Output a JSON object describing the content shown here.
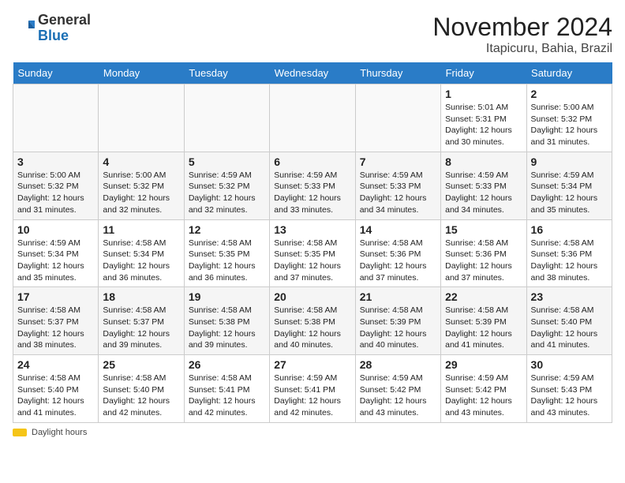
{
  "header": {
    "logo_general": "General",
    "logo_blue": "Blue",
    "month_title": "November 2024",
    "location": "Itapicuru, Bahia, Brazil"
  },
  "legend": {
    "icon": "sun-icon",
    "label": "Daylight hours"
  },
  "weekdays": [
    "Sunday",
    "Monday",
    "Tuesday",
    "Wednesday",
    "Thursday",
    "Friday",
    "Saturday"
  ],
  "weeks": [
    [
      {
        "day": "",
        "details": ""
      },
      {
        "day": "",
        "details": ""
      },
      {
        "day": "",
        "details": ""
      },
      {
        "day": "",
        "details": ""
      },
      {
        "day": "",
        "details": ""
      },
      {
        "day": "1",
        "details": "Sunrise: 5:01 AM\nSunset: 5:31 PM\nDaylight: 12 hours and 30 minutes."
      },
      {
        "day": "2",
        "details": "Sunrise: 5:00 AM\nSunset: 5:32 PM\nDaylight: 12 hours and 31 minutes."
      }
    ],
    [
      {
        "day": "3",
        "details": "Sunrise: 5:00 AM\nSunset: 5:32 PM\nDaylight: 12 hours and 31 minutes."
      },
      {
        "day": "4",
        "details": "Sunrise: 5:00 AM\nSunset: 5:32 PM\nDaylight: 12 hours and 32 minutes."
      },
      {
        "day": "5",
        "details": "Sunrise: 4:59 AM\nSunset: 5:32 PM\nDaylight: 12 hours and 32 minutes."
      },
      {
        "day": "6",
        "details": "Sunrise: 4:59 AM\nSunset: 5:33 PM\nDaylight: 12 hours and 33 minutes."
      },
      {
        "day": "7",
        "details": "Sunrise: 4:59 AM\nSunset: 5:33 PM\nDaylight: 12 hours and 34 minutes."
      },
      {
        "day": "8",
        "details": "Sunrise: 4:59 AM\nSunset: 5:33 PM\nDaylight: 12 hours and 34 minutes."
      },
      {
        "day": "9",
        "details": "Sunrise: 4:59 AM\nSunset: 5:34 PM\nDaylight: 12 hours and 35 minutes."
      }
    ],
    [
      {
        "day": "10",
        "details": "Sunrise: 4:59 AM\nSunset: 5:34 PM\nDaylight: 12 hours and 35 minutes."
      },
      {
        "day": "11",
        "details": "Sunrise: 4:58 AM\nSunset: 5:34 PM\nDaylight: 12 hours and 36 minutes."
      },
      {
        "day": "12",
        "details": "Sunrise: 4:58 AM\nSunset: 5:35 PM\nDaylight: 12 hours and 36 minutes."
      },
      {
        "day": "13",
        "details": "Sunrise: 4:58 AM\nSunset: 5:35 PM\nDaylight: 12 hours and 37 minutes."
      },
      {
        "day": "14",
        "details": "Sunrise: 4:58 AM\nSunset: 5:36 PM\nDaylight: 12 hours and 37 minutes."
      },
      {
        "day": "15",
        "details": "Sunrise: 4:58 AM\nSunset: 5:36 PM\nDaylight: 12 hours and 37 minutes."
      },
      {
        "day": "16",
        "details": "Sunrise: 4:58 AM\nSunset: 5:36 PM\nDaylight: 12 hours and 38 minutes."
      }
    ],
    [
      {
        "day": "17",
        "details": "Sunrise: 4:58 AM\nSunset: 5:37 PM\nDaylight: 12 hours and 38 minutes."
      },
      {
        "day": "18",
        "details": "Sunrise: 4:58 AM\nSunset: 5:37 PM\nDaylight: 12 hours and 39 minutes."
      },
      {
        "day": "19",
        "details": "Sunrise: 4:58 AM\nSunset: 5:38 PM\nDaylight: 12 hours and 39 minutes."
      },
      {
        "day": "20",
        "details": "Sunrise: 4:58 AM\nSunset: 5:38 PM\nDaylight: 12 hours and 40 minutes."
      },
      {
        "day": "21",
        "details": "Sunrise: 4:58 AM\nSunset: 5:39 PM\nDaylight: 12 hours and 40 minutes."
      },
      {
        "day": "22",
        "details": "Sunrise: 4:58 AM\nSunset: 5:39 PM\nDaylight: 12 hours and 41 minutes."
      },
      {
        "day": "23",
        "details": "Sunrise: 4:58 AM\nSunset: 5:40 PM\nDaylight: 12 hours and 41 minutes."
      }
    ],
    [
      {
        "day": "24",
        "details": "Sunrise: 4:58 AM\nSunset: 5:40 PM\nDaylight: 12 hours and 41 minutes."
      },
      {
        "day": "25",
        "details": "Sunrise: 4:58 AM\nSunset: 5:40 PM\nDaylight: 12 hours and 42 minutes."
      },
      {
        "day": "26",
        "details": "Sunrise: 4:58 AM\nSunset: 5:41 PM\nDaylight: 12 hours and 42 minutes."
      },
      {
        "day": "27",
        "details": "Sunrise: 4:59 AM\nSunset: 5:41 PM\nDaylight: 12 hours and 42 minutes."
      },
      {
        "day": "28",
        "details": "Sunrise: 4:59 AM\nSunset: 5:42 PM\nDaylight: 12 hours and 43 minutes."
      },
      {
        "day": "29",
        "details": "Sunrise: 4:59 AM\nSunset: 5:42 PM\nDaylight: 12 hours and 43 minutes."
      },
      {
        "day": "30",
        "details": "Sunrise: 4:59 AM\nSunset: 5:43 PM\nDaylight: 12 hours and 43 minutes."
      }
    ]
  ]
}
